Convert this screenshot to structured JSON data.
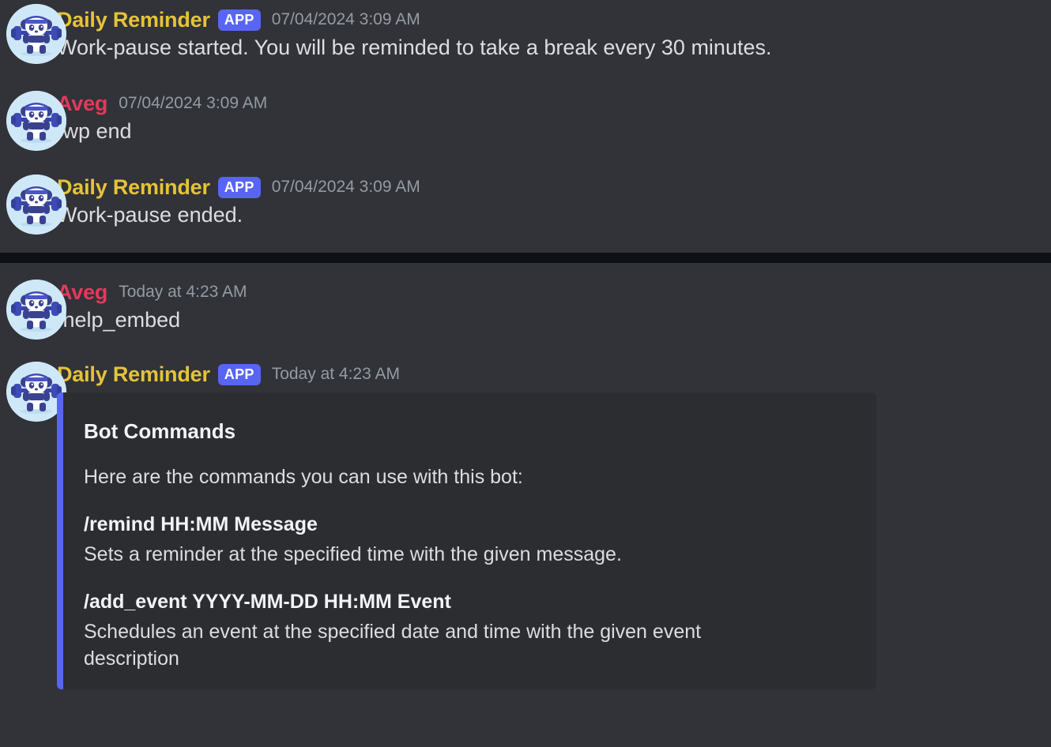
{
  "theme": {
    "background": "#313338",
    "embed_background": "#2b2d31",
    "divider_band": "#0e1114",
    "bot_name_color": "#e5c339",
    "user_name_color": "#e13a5c",
    "accent_blurple": "#5865f2",
    "timestamp_color": "#949ba4",
    "body_text_color": "#dbdee1",
    "avatar_background": "#cfe8f7"
  },
  "avatar": {
    "icon_name": "panda-weightlifter-avatar",
    "alt": "Panda lifting a barbell"
  },
  "badges": {
    "app": "APP"
  },
  "messages": [
    {
      "id": "m1",
      "author": "Daily Reminder",
      "author_type": "bot",
      "badge": "APP",
      "timestamp": "07/04/2024 3:09 AM",
      "text": "Work-pause started. You will be reminded to take a break every 30 minutes."
    },
    {
      "id": "m2",
      "author": "Aveg",
      "author_type": "human",
      "badge": "",
      "timestamp": "07/04/2024 3:09 AM",
      "text": "/wp end"
    },
    {
      "id": "m3",
      "author": "Daily Reminder",
      "author_type": "bot",
      "badge": "APP",
      "timestamp": "07/04/2024 3:09 AM",
      "text": "Work-pause ended."
    },
    {
      "id": "m4",
      "author": "Aveg",
      "author_type": "human",
      "badge": "",
      "timestamp": "Today at 4:23 AM",
      "text": "/help_embed"
    },
    {
      "id": "m5",
      "author": "Daily Reminder",
      "author_type": "bot",
      "badge": "APP",
      "timestamp": "Today at 4:23 AM",
      "text": ""
    }
  ],
  "embed": {
    "title": "Bot Commands",
    "description": "Here are the commands you can use with this bot:",
    "accent_color": "#5865f2",
    "fields": [
      {
        "name": "/remind HH:MM Message",
        "value": "Sets a reminder at the specified time with the given message."
      },
      {
        "name": "/add_event YYYY-MM-DD HH:MM Event",
        "value": "Schedules an event at the specified date and time with the given event description"
      }
    ]
  }
}
